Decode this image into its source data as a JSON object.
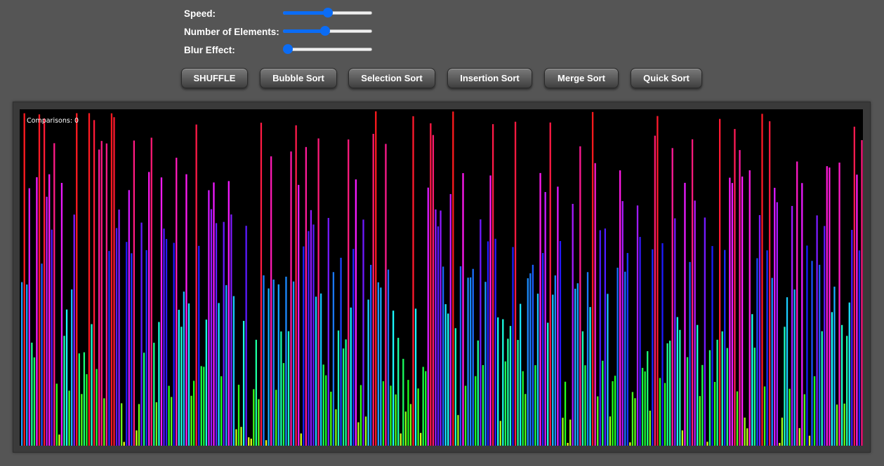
{
  "controls": {
    "speed": {
      "label": "Speed:",
      "value": 0.5
    },
    "elements": {
      "label": "Number of Elements:",
      "value": 0.47
    },
    "blur": {
      "label": "Blur Effect:",
      "value": 0.0
    }
  },
  "buttons": {
    "shuffle": "SHUFFLE",
    "bubble": "Bubble Sort",
    "selection": "Selection Sort",
    "insertion": "Insertion Sort",
    "merge": "Merge Sort",
    "quick": "Quick Sort"
  },
  "visualizer": {
    "comparisons_label": "Comparisons: 0"
  }
}
